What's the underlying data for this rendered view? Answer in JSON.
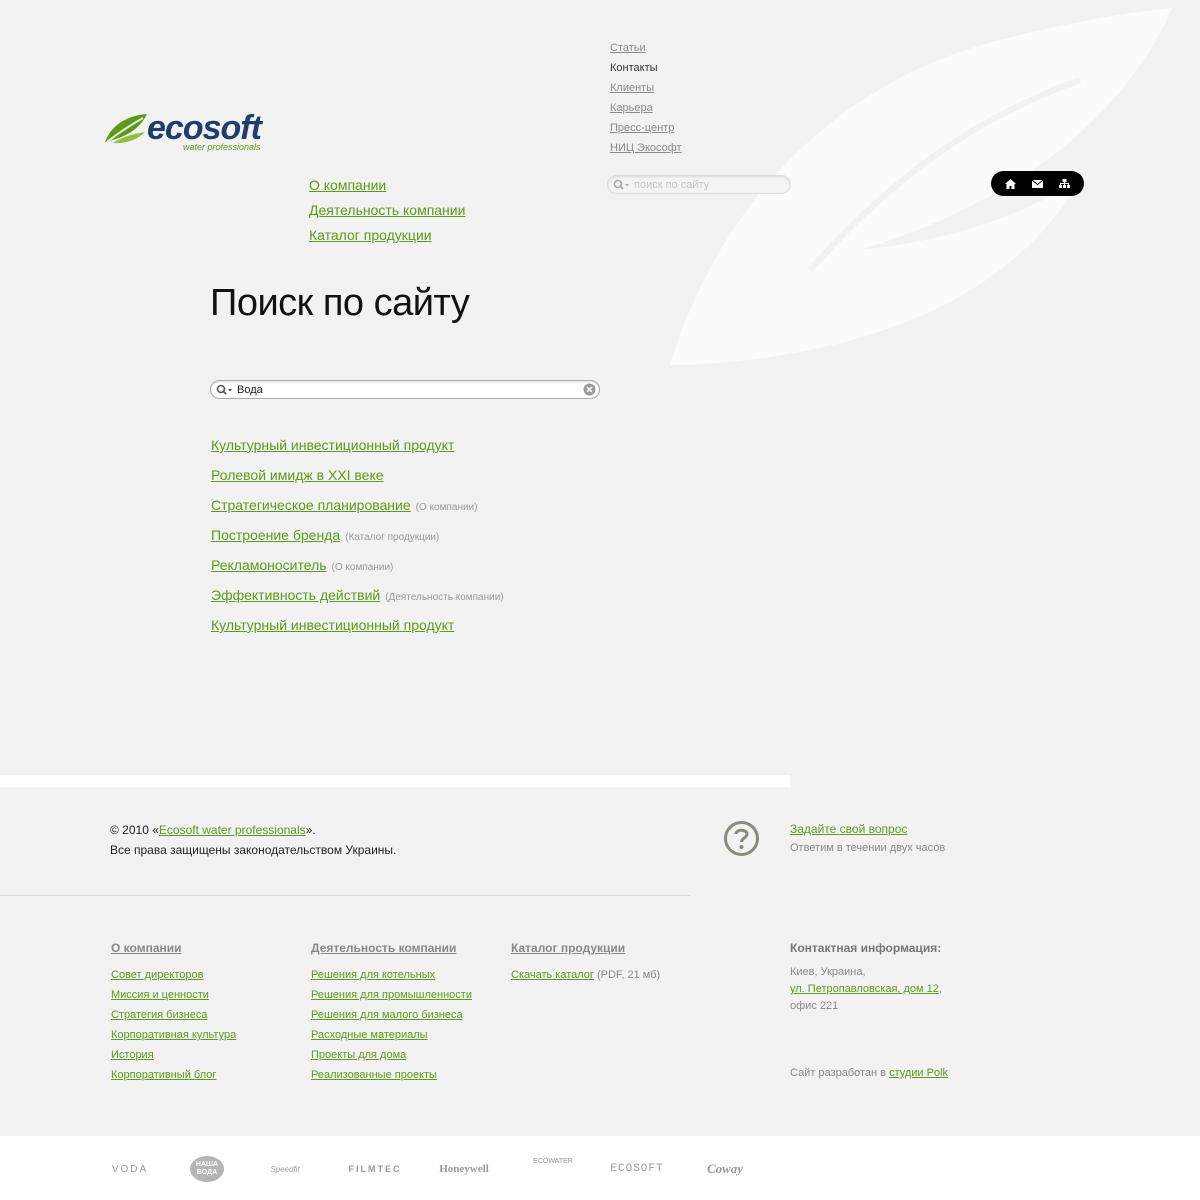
{
  "logo": {
    "word": "ecosoft",
    "tagline": "water professionals"
  },
  "top_links": [
    {
      "label": "Статьи",
      "current": false
    },
    {
      "label": "Контакты",
      "current": true
    },
    {
      "label": "Клиенты",
      "current": false
    },
    {
      "label": "Карьера",
      "current": false
    },
    {
      "label": "Пресс-центр",
      "current": false
    },
    {
      "label": "НИЦ Экософт",
      "current": false
    }
  ],
  "main_nav": [
    "О компании",
    "Деятельность компании",
    "Каталог продукции"
  ],
  "header_search": {
    "placeholder": "поиск по сайту",
    "value": ""
  },
  "icon_bar": [
    "home-icon",
    "mail-icon",
    "sitemap-icon"
  ],
  "page_title": "Поиск по сайту",
  "search": {
    "value": "Вода"
  },
  "results": [
    {
      "title": "Культурный инвестиционный продукт",
      "category": ""
    },
    {
      "title": "Ролевой имидж в XXI веке",
      "category": ""
    },
    {
      "title": "Стратегическое планирование",
      "category": "(О компании)"
    },
    {
      "title": "Построение бренда",
      "category": "(Каталог продукции)"
    },
    {
      "title": "Рекламоноситель",
      "category": "(О компании)"
    },
    {
      "title": "Эффективность действий",
      "category": "(Деятельность компании)"
    },
    {
      "title": "Культурный инвестиционный продукт",
      "category": ""
    }
  ],
  "footer": {
    "copyright_prefix": "© 2010 «",
    "copyright_link": "Ecosoft water professionals",
    "copyright_suffix": "».",
    "rights": "Все права защищены законодательством Украины.",
    "ask_link": "Задайте свой вопрос",
    "ask_sub": "Ответим в течении двух часов",
    "columns": [
      {
        "head": "О компании",
        "items": [
          "Совет директоров",
          "Миссия и ценности",
          "Стратегия бизнеса",
          "Корпоративная культура",
          "История",
          "Корпоративный блог"
        ]
      },
      {
        "head": "Деятельность компании",
        "items": [
          "Решения для котельных",
          "Решения для промышленности",
          "Решения для малого бизнеса",
          "Расходные материалы",
          "Проекты для дома",
          "Реализованные проекты"
        ]
      },
      {
        "head": "Каталог продукции",
        "items": [
          "Скачать каталог"
        ],
        "note": "(PDF, 21 мб)"
      }
    ],
    "contacts": {
      "head": "Контактная информация:",
      "city": "Киев, Украина,",
      "street": "ул. Петропавловская, дом 12",
      "comma": ",",
      "office": "офис 221"
    },
    "dev_prefix": "Сайт разработан в ",
    "dev_link": "студии Polk"
  },
  "partners": [
    "VODA",
    "НАША ВОДА",
    "Speedfit",
    "FILMTEC",
    "Honeywell",
    "ECOWATER",
    "ECOSOFT",
    "Coway"
  ],
  "colors": {
    "green": "#5c9a1b",
    "navy": "#1f3d6f",
    "bg": "#f2f2f2"
  }
}
